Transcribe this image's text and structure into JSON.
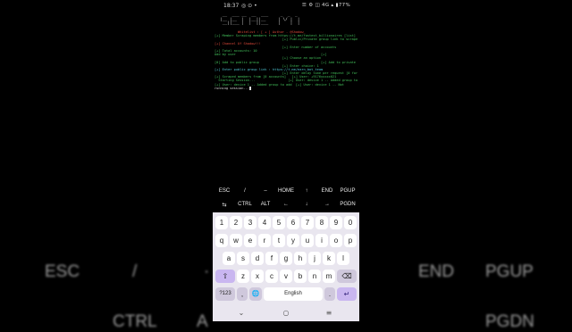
{
  "status_bar": {
    "time": "18:37",
    "left_icons": "◎ ⊙ •",
    "right_text": "☰ ⚙ ◫ 4G ▴ ▮77%"
  },
  "terminal": {
    "banner": " __  ___ __  __  ___     _  _  _\n|__ |__  |  |__||__     | \\/ |  |\n __||___ |  |  ||___    |    |  |",
    "lines": [
      {
        "text": "            Whitelist : [ + ] Author - @Shadow_",
        "cls": "c-red"
      },
      {
        "text": "[+] Member Scraping members from https://t.me/fastest_billionaires [list] +",
        "cls": "c-green"
      },
      {
        "text": "                                   [+] Public/Private group link to scrape members",
        "cls": "c-green"
      },
      {
        "text": "[+] Channel Of Shadow!!!",
        "cls": "c-red"
      },
      {
        "text": "                                   [+] Enter number of accounts",
        "cls": "c-green"
      },
      {
        "text": "[+] Total accounts: 10",
        "cls": "c-green"
      },
      {
        "text": "Add by user                                            [+]",
        "cls": "c-green"
      },
      {
        "text": "                                   [+] Choose an option",
        "cls": "c-green"
      },
      {
        "text": "[0] Add to public group                                [+] Add to private group",
        "cls": "c-green"
      },
      {
        "text": "                                   [+] Enter choice: 1",
        "cls": "c-green"
      },
      {
        "text": "[+] Enter public group link : https://t.me/earn_bot_team",
        "cls": "c-cyan"
      },
      {
        "text": "                                   [+] Enter delay time per request [0 for None]: 0",
        "cls": "c-green"
      },
      {
        "text": "[+] Scraped members from [0 accounts]   [+] User: +9176xxxxx021",
        "cls": "c-green"
      },
      {
        "text": "  Starting Session...                 [+] User: device 1 -- Added group to scrape",
        "cls": "c-green"
      },
      {
        "text": "[+] User: device 1 -- Added group to add  [+] User: device 1 -- Not",
        "cls": "c-green"
      },
      {
        "text": "running session...",
        "cls": "c-white"
      }
    ]
  },
  "extra_keys": {
    "row1": [
      "ESC",
      "/",
      "–",
      "HOME",
      "↑",
      "END",
      "PGUP"
    ],
    "row2": [
      "⇆",
      "CTRL",
      "ALT",
      "←",
      "↓",
      "→",
      "PGDN"
    ]
  },
  "keyboard": {
    "row_numbers": [
      "1",
      "2",
      "3",
      "4",
      "5",
      "6",
      "7",
      "8",
      "9",
      "0"
    ],
    "row_q": [
      "q",
      "w",
      "e",
      "r",
      "t",
      "y",
      "u",
      "i",
      "o",
      "p"
    ],
    "row_a": [
      "a",
      "s",
      "d",
      "f",
      "g",
      "h",
      "j",
      "k",
      "l"
    ],
    "row_z": [
      "z",
      "x",
      "c",
      "v",
      "b",
      "n",
      "m"
    ],
    "shift": "⇧",
    "backspace": "⌫",
    "symbols": "?123",
    "comma": ",",
    "globe": "🌐",
    "space": "English",
    "period": ".",
    "enter": "↵"
  },
  "navbar": {
    "recents": "⌄",
    "home": "○",
    "back": "≡"
  },
  "background_keys": {
    "row1": [
      "ESC",
      "/",
      "·",
      "END",
      "PGUP"
    ],
    "row2": [
      "CTRL",
      "A",
      "PGDN"
    ]
  }
}
